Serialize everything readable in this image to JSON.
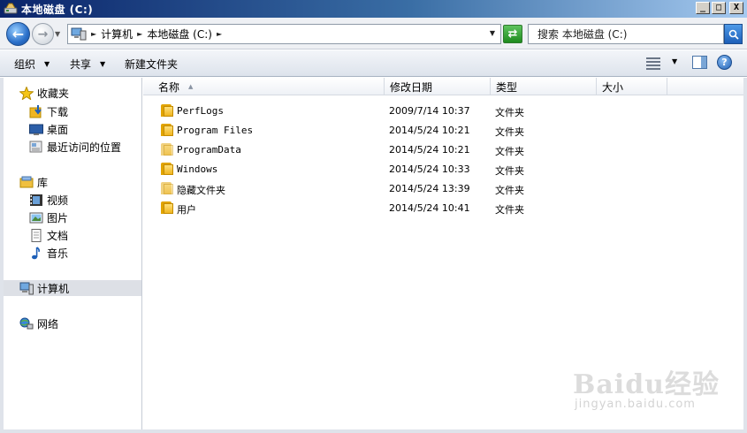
{
  "window": {
    "title": "本地磁盘 (C:)",
    "controls": {
      "minimize": "_",
      "maximize": "□",
      "close": "X"
    }
  },
  "address": {
    "crumbs": [
      "计算机",
      "本地磁盘 (C:)"
    ],
    "search_placeholder": "搜索 本地磁盘 (C:)"
  },
  "toolbar": {
    "organize": "组织",
    "share": "共享",
    "new_folder": "新建文件夹"
  },
  "nav": {
    "favorites": {
      "label": "收藏夹",
      "items": [
        "下载",
        "桌面",
        "最近访问的位置"
      ]
    },
    "libraries": {
      "label": "库",
      "items": [
        "视频",
        "图片",
        "文档",
        "音乐"
      ]
    },
    "computer": "计算机",
    "network": "网络"
  },
  "columns": {
    "name": "名称",
    "modified": "修改日期",
    "type": "类型",
    "size": "大小"
  },
  "files": [
    {
      "name": "PerfLogs",
      "modified": "2009/7/14 10:37",
      "type": "文件夹",
      "size": "",
      "hidden": false
    },
    {
      "name": "Program Files",
      "modified": "2014/5/24 10:21",
      "type": "文件夹",
      "size": "",
      "hidden": false
    },
    {
      "name": "ProgramData",
      "modified": "2014/5/24 10:21",
      "type": "文件夹",
      "size": "",
      "hidden": true
    },
    {
      "name": "Windows",
      "modified": "2014/5/24 10:33",
      "type": "文件夹",
      "size": "",
      "hidden": false
    },
    {
      "name": "隐藏文件夹",
      "modified": "2014/5/24 13:39",
      "type": "文件夹",
      "size": "",
      "hidden": true
    },
    {
      "name": "用户",
      "modified": "2014/5/24 10:41",
      "type": "文件夹",
      "size": "",
      "hidden": false
    }
  ],
  "watermark": {
    "brand": "Baidu经验",
    "url": "jingyan.baidu.com"
  },
  "colors": {
    "titlebar_start": "#0a246a",
    "titlebar_end": "#a6caf0",
    "folder": "#f0b520",
    "selection": "#dde0e6"
  },
  "icons": [
    "drive-icon",
    "back-arrow-icon",
    "forward-arrow-icon",
    "refresh-icon",
    "search-icon",
    "views-icon",
    "preview-pane-icon",
    "help-icon",
    "star-icon",
    "download-folder-icon",
    "desktop-icon",
    "recent-places-icon",
    "library-icon",
    "video-icon",
    "picture-icon",
    "document-icon",
    "music-icon",
    "computer-icon",
    "network-icon",
    "folder-icon"
  ]
}
